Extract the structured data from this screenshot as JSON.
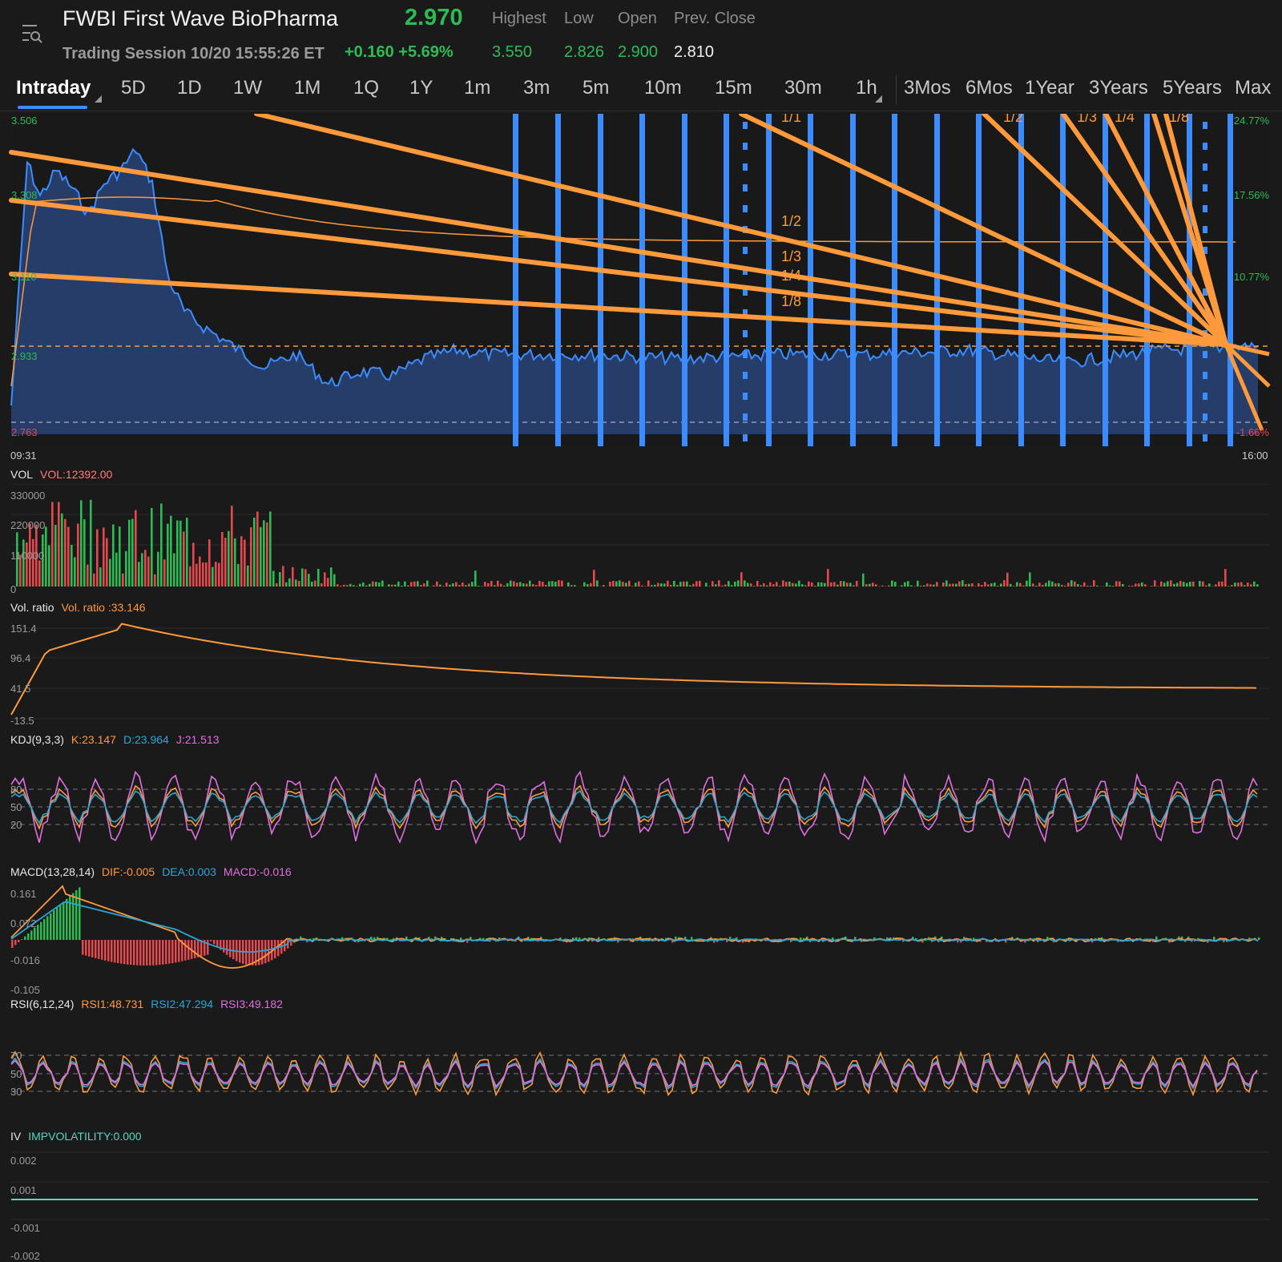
{
  "header": {
    "menu_icon": "search-menu-icon",
    "title": "FWBI First Wave BioPharma",
    "price": "2.970",
    "labels": {
      "high": "Highest",
      "low": "Low",
      "open": "Open",
      "prev_close": "Prev. Close"
    },
    "session": "Trading Session 10/20 15:55:26 ET",
    "change": "+0.160 +5.69%",
    "values": {
      "high": "3.550",
      "low": "2.826",
      "open": "2.900",
      "prev_close": "2.810"
    }
  },
  "tabs": [
    "Intraday",
    "5D",
    "1D",
    "1W",
    "1M",
    "1Q",
    "1Y",
    "1m",
    "3m",
    "5m",
    "10m",
    "15m",
    "30m",
    "1h",
    "3Mos",
    "6Mos",
    "1Year",
    "3Years",
    "5Years",
    "Max"
  ],
  "active_tab": "Intraday",
  "colors": {
    "up": "#2bbd53",
    "down": "#e5484d",
    "blue": "#3b8cff",
    "orange": "#ff9a3c",
    "cyan": "#2aa7d8",
    "pink": "#e06fe0",
    "teal": "#55d6c0"
  },
  "price_panel": {
    "y_ticks_left": [
      "3.506",
      "3.308",
      "3.110",
      "2.933",
      "2.763"
    ],
    "y_ticks_right": [
      "24.77%",
      "17.56%",
      "10.77%",
      "-1.66%"
    ],
    "x_start": "09:31",
    "x_end": "16:00",
    "fan_labels": [
      "1/1",
      "1/2",
      "1/3",
      "1/4",
      "1/8",
      "1/2",
      "1/3",
      "1/4",
      "1/8"
    ]
  },
  "vol_panel": {
    "label": "VOL",
    "value": "VOL:12392.00",
    "ticks": [
      "330000",
      "220000",
      "110000",
      "0"
    ]
  },
  "volratio_panel": {
    "label": "Vol. ratio",
    "value": "Vol. ratio :33.146",
    "ticks": [
      "151.4",
      "96.4",
      "41.5",
      "-13.5"
    ]
  },
  "kdj_panel": {
    "label": "KDJ(9,3,3)",
    "k": "K:23.147",
    "d": "D:23.964",
    "j": "J:21.513",
    "ticks": [
      "80",
      "50",
      "20"
    ]
  },
  "macd_panel": {
    "label": "MACD(13,28,14)",
    "dif": "DIF:-0.005",
    "dea": "DEA:0.003",
    "macd": "MACD:-0.016",
    "ticks": [
      "0.161",
      "0.072",
      "-0.016",
      "-0.105"
    ]
  },
  "rsi_panel": {
    "label": "RSI(6,12,24)",
    "rsi1": "RSI1:48.731",
    "rsi2": "RSI2:47.294",
    "rsi3": "RSI3:49.182",
    "ticks": [
      "70",
      "50",
      "30"
    ]
  },
  "iv_panel": {
    "label": "IV",
    "value": "IMPVOLATILITY:0.000",
    "ticks": [
      "0.002",
      "0.001",
      "-0.001",
      "-0.002"
    ]
  },
  "chart_data": {
    "type": "line",
    "x_range": [
      "09:31",
      "16:00"
    ],
    "ylim": [
      2.763,
      3.506
    ],
    "price_polyline": [
      [
        "09:31",
        2.83
      ],
      [
        "09:36",
        3.4
      ],
      [
        "09:40",
        3.32
      ],
      [
        "09:45",
        3.38
      ],
      [
        "09:50",
        3.34
      ],
      [
        "09:55",
        3.28
      ],
      [
        "10:00",
        3.35
      ],
      [
        "10:05",
        3.38
      ],
      [
        "10:10",
        3.43
      ],
      [
        "10:15",
        3.35
      ],
      [
        "10:20",
        3.13
      ],
      [
        "10:25",
        3.05
      ],
      [
        "10:30",
        3.02
      ],
      [
        "10:40",
        2.97
      ],
      [
        "10:50",
        2.92
      ],
      [
        "11:00",
        2.95
      ],
      [
        "11:10",
        2.88
      ],
      [
        "11:20",
        2.91
      ],
      [
        "11:30",
        2.9
      ],
      [
        "11:40",
        2.94
      ],
      [
        "11:50",
        2.96
      ],
      [
        "12:00",
        2.95
      ],
      [
        "12:30",
        2.95
      ],
      [
        "13:00",
        2.94
      ],
      [
        "13:30",
        2.95
      ],
      [
        "14:00",
        2.95
      ],
      [
        "14:30",
        2.96
      ],
      [
        "15:00",
        2.93
      ],
      [
        "15:30",
        2.96
      ],
      [
        "16:00",
        2.97
      ]
    ],
    "indicator_values": {
      "vol": 12392.0,
      "vol_ratio": 33.146,
      "kdj": {
        "k": 23.147,
        "d": 23.964,
        "j": 21.513
      },
      "macd": {
        "dif": -0.005,
        "dea": 0.003,
        "macd": -0.016
      },
      "rsi": {
        "rsi1": 48.731,
        "rsi2": 47.294,
        "rsi3": 49.182
      },
      "iv": 0.0
    }
  }
}
